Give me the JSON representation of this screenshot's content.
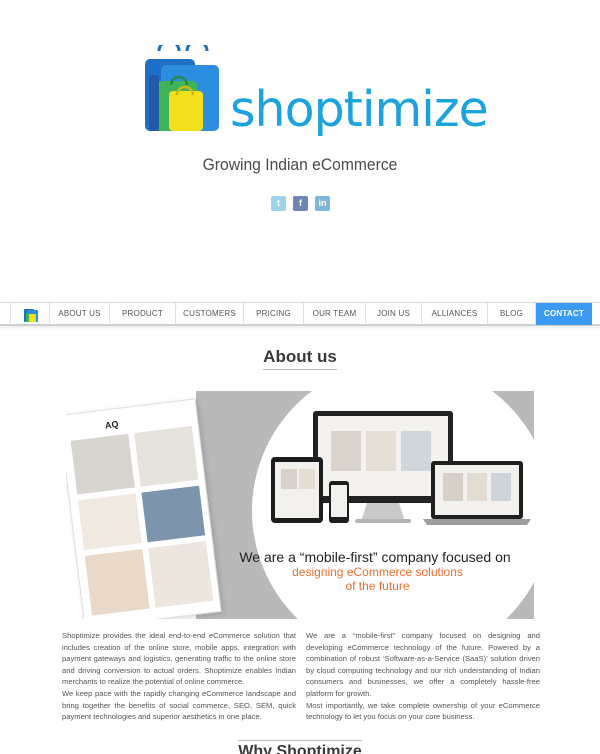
{
  "brand": {
    "name": "shoptimize",
    "tagline": "Growing Indian eCommerce"
  },
  "social": [
    {
      "name": "twitter-icon",
      "glyph": "t"
    },
    {
      "name": "facebook-icon",
      "glyph": "f"
    },
    {
      "name": "linkedin-icon",
      "glyph": "in"
    }
  ],
  "nav": {
    "items": [
      "ABOUT US",
      "PRODUCT",
      "CUSTOMERS",
      "PRICING",
      "OUR TEAM",
      "JOIN US",
      "ALLIANCES",
      "BLOG",
      "CONTACT"
    ]
  },
  "about": {
    "title": "About us",
    "banner": {
      "line1": "We are a “mobile-first” company focused on",
      "line2": "designing eCommerce solutions",
      "line3": "of the future",
      "mockup_logo": "AQ"
    },
    "left_col": "Shoptimize provides the ideal end-to-end eCommerce solution that includes creation of the online store, mobile apps, integration with payment gateways and logistics, generating traffic to the online store and driving conversion to actual orders. Shoptimize enables Indian merchants to realize the potential of online commerce.",
    "left_col_2": "We keep pace with the rapidly changing eCommerce landscape and bring together the benefits of social commerce, SEO, SEM, quick payment technologies and superior aesthetics in one place.",
    "right_col": "We are a “mobile-first” company focused on designing and developing eCommerce technology of the future. Powered by a combination of robust ‘Software-as-a-Service (SaaS)’ solution driven by cloud computing technology and our rich understanding of Indian consumers and businesses, we offer a completely hassle-free platform for growth.",
    "right_col_2": "Most importantly, we take complete ownership of your eCommerce technology to let you focus on your core business."
  },
  "why": {
    "title": "Why Shoptimize"
  },
  "colors": {
    "brand_blue": "#1aa3dd",
    "contact_blue": "#3b9bf2",
    "orange": "#ec6d2c"
  }
}
